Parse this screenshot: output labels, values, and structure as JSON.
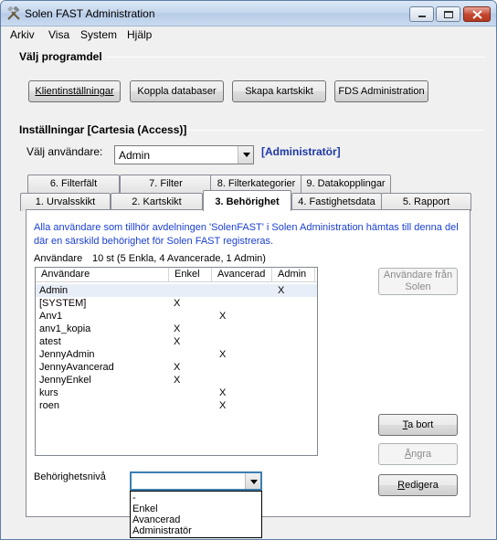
{
  "window": {
    "title": "Solen FAST Administration",
    "icon": "tools-icon"
  },
  "menu": [
    "Arkiv",
    "Visa",
    "System",
    "Hjälp"
  ],
  "program_section": {
    "title": "Välj programdel",
    "buttons": [
      "Klientinställningar",
      "Koppla databaser",
      "Skapa kartskikt",
      "FDS Administration"
    ]
  },
  "settings_section": {
    "title": "Inställningar [Cartesia (Access)]",
    "user_label": "Välj användare:",
    "user_value": "Admin",
    "role_tag": "[Administratör]"
  },
  "tabs_row1": [
    "6. Filterfält",
    "7. Filter",
    "8. Filterkategorier",
    "9. Datakopplingar"
  ],
  "tabs_row2": [
    "1. Urvalsskikt",
    "2. Kartskikt",
    "3. Behörighet",
    "4. Fastighetsdata",
    "5. Rapport"
  ],
  "active_tab": "3. Behörighet",
  "panel": {
    "info": "Alla användare som tillhör avdelningen 'SolenFAST' i Solen Administration hämtas till denna del där en särskild behörighet för Solen FAST registreras.",
    "users_label": "Användare",
    "users_count": "10 st (5 Enkla, 4 Avancerade, 1 Admin)",
    "columns": [
      "Användare",
      "Enkel",
      "Avancerad",
      "Admin"
    ],
    "rows": [
      {
        "name": "Admin",
        "enkel": "",
        "avancerad": "",
        "admin": "X"
      },
      {
        "name": "[SYSTEM]",
        "enkel": "X",
        "avancerad": "",
        "admin": ""
      },
      {
        "name": "Anv1",
        "enkel": "",
        "avancerad": "X",
        "admin": ""
      },
      {
        "name": "anv1_kopia",
        "enkel": "X",
        "avancerad": "",
        "admin": ""
      },
      {
        "name": "atest",
        "enkel": "X",
        "avancerad": "",
        "admin": ""
      },
      {
        "name": "JennyAdmin",
        "enkel": "",
        "avancerad": "X",
        "admin": ""
      },
      {
        "name": "JennyAvancerad",
        "enkel": "X",
        "avancerad": "",
        "admin": ""
      },
      {
        "name": "JennyEnkel",
        "enkel": "X",
        "avancerad": "",
        "admin": ""
      },
      {
        "name": "kurs",
        "enkel": "",
        "avancerad": "X",
        "admin": ""
      },
      {
        "name": "roen",
        "enkel": "",
        "avancerad": "X",
        "admin": ""
      }
    ],
    "btn_users_from_solen": "Användare från Solen",
    "btn_remove_prefix": "T",
    "btn_remove_rest": "a bort",
    "btn_undo_prefix": "Å",
    "btn_undo_rest": "ngra",
    "btn_edit_prefix": "R",
    "btn_edit_rest": "edigera",
    "level_label": "Behörighetsnivå",
    "level_value": "",
    "level_options": [
      "-",
      "Enkel",
      "Avancerad",
      "Administratör"
    ]
  }
}
